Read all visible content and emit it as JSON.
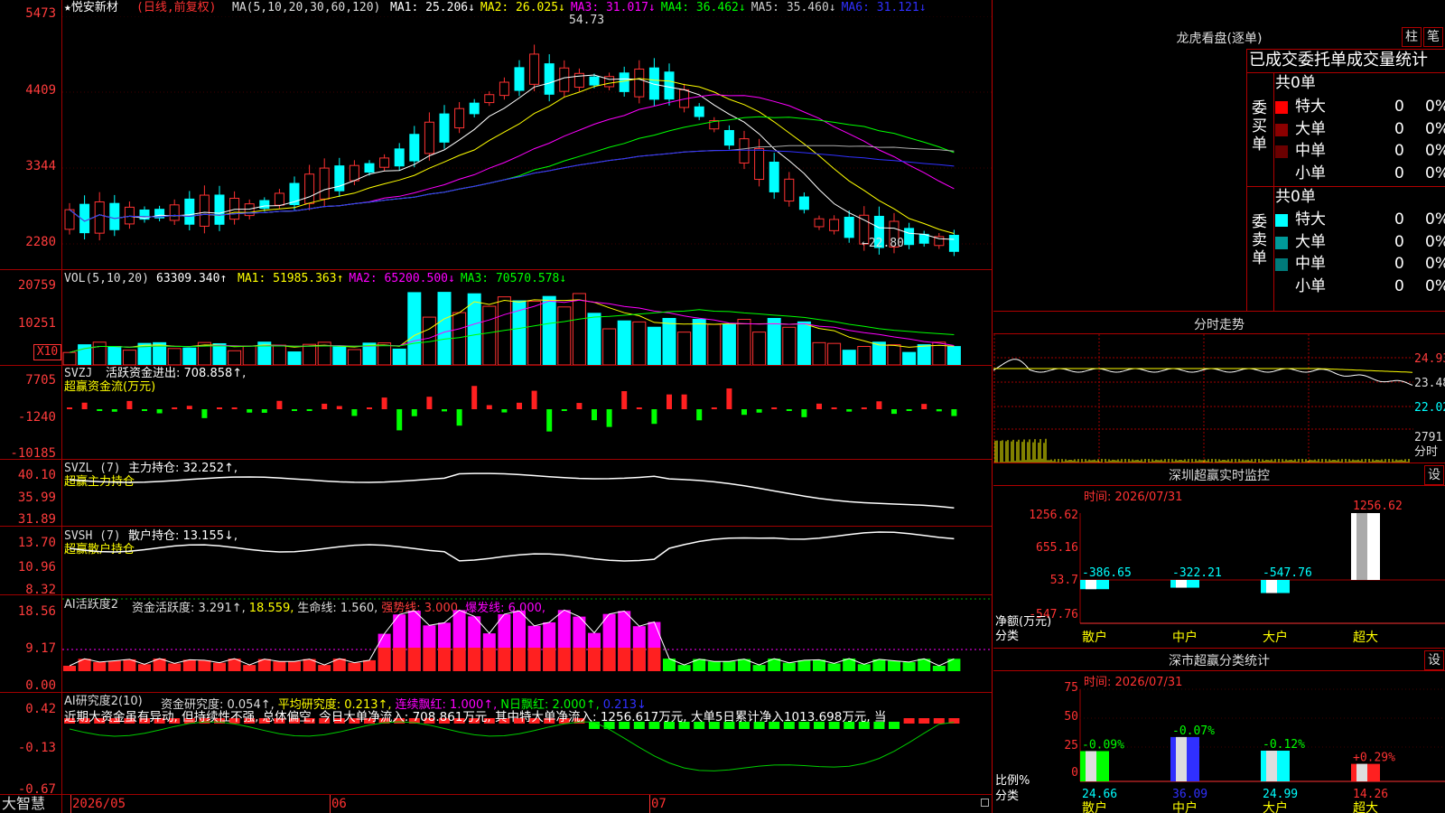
{
  "colors": {
    "up": "#ff3232",
    "down": "#00ffff",
    "grid": "#a00000",
    "bg": "#000000",
    "label": "#ff3c3c",
    "white": "#ffffff",
    "yellow": "#ffff00",
    "magenta": "#ff00ff",
    "green": "#00ff00"
  },
  "kline": {
    "stock_name": "★悦安新材",
    "period": "(日线,前复权)",
    "ma_header": "MA(5,10,20,30,60,120)",
    "ma": [
      {
        "label": "MA1:",
        "value": "25.206↓",
        "color": "#ffffff"
      },
      {
        "label": "MA2:",
        "value": "26.025↓",
        "color": "#ffff00"
      },
      {
        "label": "MA3:",
        "value": "31.017↓",
        "color": "#ff00ff"
      },
      {
        "label": "MA4:",
        "value": "36.462↓",
        "color": "#00ff00"
      },
      {
        "label": "MA5:",
        "value": "35.460↓",
        "color": "#cccccc"
      },
      {
        "label": "MA6:",
        "value": "31.121↓",
        "color": "#3030ff"
      }
    ],
    "y_labels": [
      "5473",
      "4409",
      "3344",
      "2280"
    ],
    "high_marker": "54.73",
    "low_marker": "←22.80"
  },
  "vol": {
    "header": "VOL(5,10,20)",
    "value": "63309.340↑",
    "ma": [
      {
        "label": "MA1:",
        "value": "51985.363↑",
        "color": "#ffff00"
      },
      {
        "label": "MA2:",
        "value": "65200.500↓",
        "color": "#ff00ff"
      },
      {
        "label": "MA3:",
        "value": "70570.578↓",
        "color": "#00ff00"
      }
    ],
    "y_labels": [
      "20759",
      "10251"
    ],
    "unit": "X10"
  },
  "svzj": {
    "title": "SVZJ",
    "line1": "活跃资金进出: 708.858↑,",
    "line2": "超赢资金流(万元)",
    "y_labels": [
      "7705",
      "-1240",
      "-10185"
    ]
  },
  "svzl": {
    "title": "SVZL (7)",
    "line1": "主力持仓: 32.252↑,",
    "line2": "超赢主力持仓",
    "y_labels": [
      "40.10",
      "35.99",
      "31.89"
    ]
  },
  "svsh": {
    "title": "SVSH (7)",
    "line1": "散户持仓: 13.155↓,",
    "line2": "超赢散户持仓",
    "y_labels": [
      "13.70",
      "10.96",
      "8.32"
    ]
  },
  "ai_active": {
    "title": "AI活跃度2",
    "items": [
      {
        "text": "资金活跃度: 3.291↑,",
        "color": "#dddddd"
      },
      {
        "text": "18.559,",
        "color": "#ffff00"
      },
      {
        "text": "生命线: 1.560,",
        "color": "#dddddd"
      },
      {
        "text": "强势线: 3.000,",
        "color": "#ff3c3c"
      },
      {
        "text": "爆发线: 6.000,",
        "color": "#ff00ff"
      }
    ],
    "y_labels": [
      "18.56",
      "9.17",
      "0.00"
    ]
  },
  "ai_research": {
    "title": "AI研究度2(10)",
    "items": [
      {
        "text": "资金研究度: 0.054↑,",
        "color": "#dddddd"
      },
      {
        "text": "平均研究度: 0.213↑,",
        "color": "#ffff00"
      },
      {
        "text": "连续飘红: 1.000↑,",
        "color": "#ff00ff"
      },
      {
        "text": "N日飘红: 2.000↑,",
        "color": "#00ff00"
      },
      {
        "text": "0.213↓",
        "color": "#3030ff"
      }
    ],
    "comment": "近期大资金虽有异动, 但持续性不强, 总体偏空, 今日大单净流入: 708.861万元, 其中特大单净流入: 1256.617万元, 大单5日累计净入1013.698万元, 当",
    "y_labels": [
      "0.42",
      "-0.13",
      "-0.67"
    ]
  },
  "footer": {
    "brand": "大智慧",
    "dates": [
      "2026/05",
      "06",
      "07"
    ]
  },
  "dragon": {
    "title": "龙虎看盘(逐单)",
    "btn1": "柱",
    "btn2": "笔",
    "tabs": "已成交委托单成交量统计",
    "buy": {
      "side_label": "委买单",
      "total": "共0单",
      "rows": [
        {
          "name": "特大",
          "count": "0",
          "pct": "0%",
          "color": "#ff0000"
        },
        {
          "name": "大单",
          "count": "0",
          "pct": "0%",
          "color": "#8b0000"
        },
        {
          "name": "中单",
          "count": "0",
          "pct": "0%",
          "color": "#6b0000"
        },
        {
          "name": "小单",
          "count": "0",
          "pct": "0%",
          "color": ""
        }
      ]
    },
    "sell": {
      "side_label": "委卖单",
      "total": "共0单",
      "rows": [
        {
          "name": "特大",
          "count": "0",
          "pct": "0%",
          "color": "#00ffff"
        },
        {
          "name": "大单",
          "count": "0",
          "pct": "0%",
          "color": "#009a9a"
        },
        {
          "name": "中单",
          "count": "0",
          "pct": "0%",
          "color": "#007a7a"
        },
        {
          "name": "小单",
          "count": "0",
          "pct": "0%",
          "color": ""
        }
      ]
    }
  },
  "intraday": {
    "title": "分时走势",
    "y_labels": [
      "24.93",
      "23.48",
      "22.02"
    ],
    "vol_label": "2791",
    "vol_unit": "分时"
  },
  "sz_monitor": {
    "title": "深圳超赢实时监控",
    "btn": "设",
    "time": "时间: 2026/07/31",
    "y_labels": [
      "1256.62",
      "655.16",
      "53.7",
      "-547.76"
    ],
    "y_title": "净额(万元)",
    "x_title": "分类",
    "categories": [
      "散户",
      "中户",
      "大户",
      "超大"
    ],
    "values": [
      -386.65,
      -322.21,
      -547.76,
      1256.62
    ],
    "value_labels": [
      "-386.65",
      "-322.21",
      "-547.76",
      "1256.62"
    ]
  },
  "sz_class": {
    "title": "深市超赢分类统计",
    "btn": "设",
    "time": "时间: 2026/07/31",
    "y_labels": [
      "75",
      "50",
      "25",
      "0"
    ],
    "y_title": "比例%",
    "x_title": "分类",
    "categories": [
      "散户",
      "中户",
      "大户",
      "超大"
    ],
    "values": [
      24.66,
      36.09,
      24.99,
      14.26
    ],
    "value_labels": [
      "24.66",
      "36.09",
      "24.99",
      "14.26"
    ],
    "change_labels": [
      "-0.09%",
      "-0.07%",
      "-0.12%",
      "+0.29%"
    ]
  }
}
